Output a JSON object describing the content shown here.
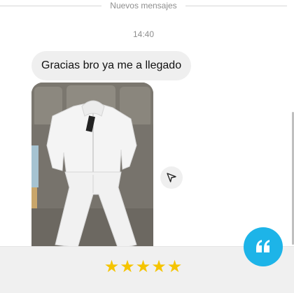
{
  "divider": {
    "label": "Nuevos mensajes"
  },
  "thread": {
    "time": "14:40",
    "messages": [
      {
        "type": "text",
        "text": "Gracias bro ya me a llegado"
      },
      {
        "type": "photo",
        "icon": "photo-white-tracksuit-on-couch"
      }
    ]
  },
  "actions": {
    "share_icon": "paper-plane-icon",
    "quote_icon": "quote-icon"
  },
  "rating": {
    "stars": "★★★★★",
    "value": 5,
    "max": 5
  },
  "colors": {
    "bubble": "#efefef",
    "accent": "#1db4e8",
    "star": "#f5c400",
    "muted_text": "#8e8e8e"
  }
}
